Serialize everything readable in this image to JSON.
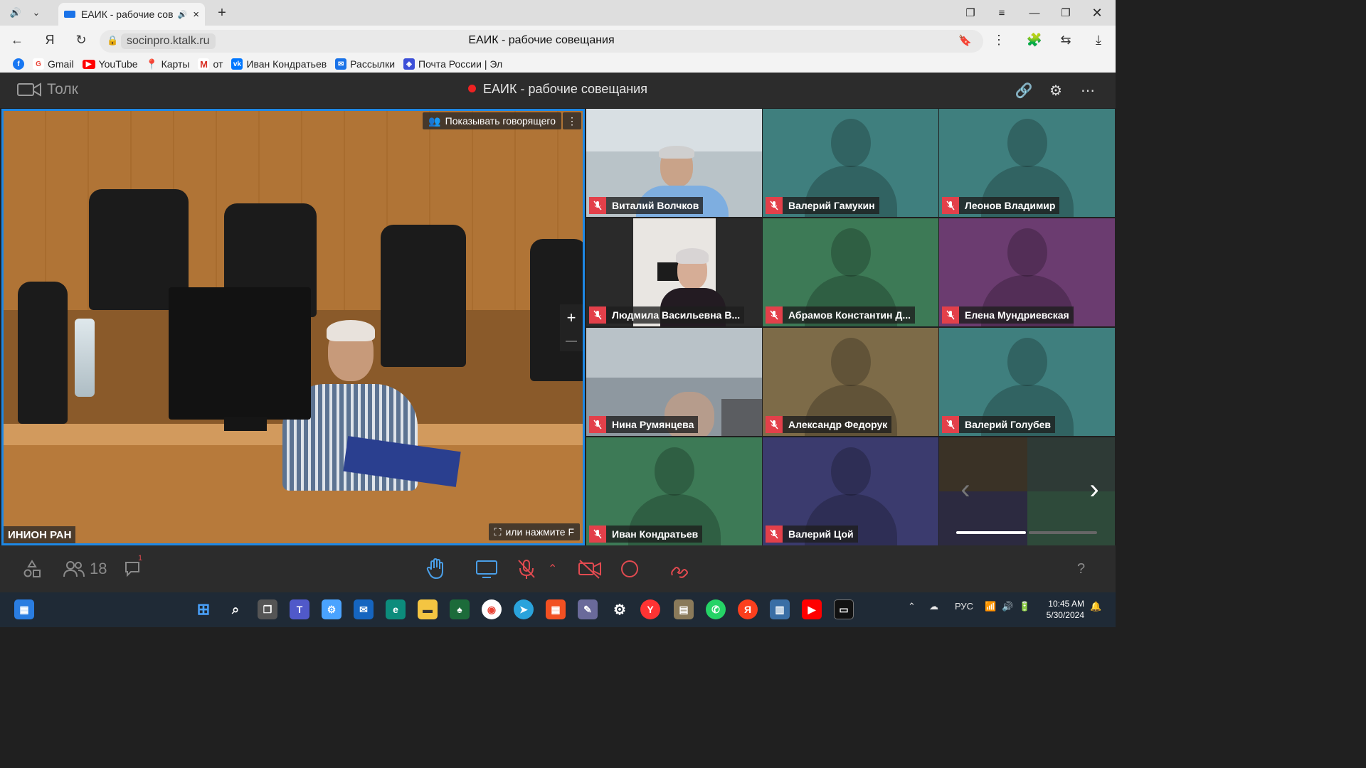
{
  "browser": {
    "tab_title": "ЕАИК - рабочие сов",
    "url": "socinpro.ktalk.ru",
    "page_title": "ЕАИК - рабочие совещания",
    "bookmarks": [
      {
        "label": "",
        "icon": "facebook-icon",
        "color": "#1877f2"
      },
      {
        "label": "Gmail",
        "icon": "google-icon",
        "color": "#ea4335"
      },
      {
        "label": "YouTube",
        "icon": "youtube-icon",
        "color": "#ff0000"
      },
      {
        "label": "Карты",
        "icon": "maps-pin-icon",
        "color": "#34a853"
      },
      {
        "label": "от",
        "icon": "gmail-m-icon",
        "color": "#d93025"
      },
      {
        "label": "Иван Кондратьев",
        "icon": "vk-icon",
        "color": "#0077ff"
      },
      {
        "label": "Рассылки",
        "icon": "mail-icon",
        "color": "#1a73e8"
      },
      {
        "label": "Почта России | Эл",
        "icon": "box-icon",
        "color": "#3c4fd8"
      }
    ]
  },
  "app": {
    "logo_text": "Толк",
    "meeting_title": "ЕАИК - рабочие совещания",
    "recording_color": "#e22222"
  },
  "main_video": {
    "show_speaker_label": "Показывать говорящего",
    "fullscreen_hint": "или нажмите F",
    "speaker_name": "ИНИОН РАН",
    "zoom_in": "+",
    "zoom_out": "—"
  },
  "participants": [
    {
      "name": "Виталий Волчков",
      "bg": "#9aa7ad",
      "video": true
    },
    {
      "name": "Валерий Гамукин",
      "bg": "#3f7f7e",
      "video": false
    },
    {
      "name": "Леонов Владимир",
      "bg": "#3f7f7e",
      "video": false
    },
    {
      "name": "Людмила Васильевна В...",
      "bg": "#2a2a2a",
      "video": true
    },
    {
      "name": "Абрамов Константин Д...",
      "bg": "#3d7a56",
      "video": false
    },
    {
      "name": "Елена Мундриевская",
      "bg": "#6b3c70",
      "video": false
    },
    {
      "name": "Нина Румянцева",
      "bg": "#8e98a0",
      "video": true
    },
    {
      "name": "Александр Федорук",
      "bg": "#7d6b48",
      "video": false
    },
    {
      "name": "Валерий Голубев",
      "bg": "#3f7f7e",
      "video": false
    },
    {
      "name": "Иван Кондратьев",
      "bg": "#3d7a56",
      "video": false
    },
    {
      "name": "Валерий Цой",
      "bg": "#3b3b6e",
      "video": false
    }
  ],
  "toolbar": {
    "participants_count": "18",
    "chat_badge": "1",
    "help": "?"
  },
  "taskbar": {
    "language": "РУС",
    "time": "10:45 AM",
    "date": "5/30/2024"
  }
}
